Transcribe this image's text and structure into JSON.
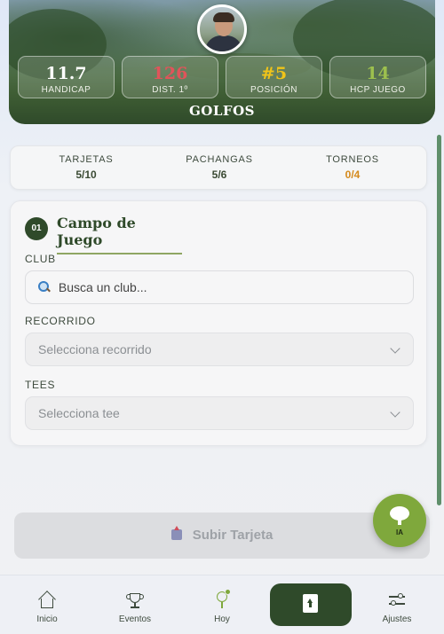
{
  "hero": {
    "title": "GOLFOS",
    "stats": [
      {
        "value": "11.7",
        "label": "HANDICAP",
        "color": "#ffffff"
      },
      {
        "value": "126",
        "label": "DIST. 1º",
        "color": "#e0545a"
      },
      {
        "value": "#5",
        "label": "POSICIÓN",
        "color": "#f0c419"
      },
      {
        "value": "14",
        "label": "HCP JUEGO",
        "color": "#9dc04e"
      }
    ]
  },
  "counters": [
    {
      "label": "TARJETAS",
      "value": "5/10"
    },
    {
      "label": "PACHANGAS",
      "value": "5/6"
    },
    {
      "label": "TORNEOS",
      "value": "0/4",
      "color": "#d58a1c"
    }
  ],
  "form": {
    "step": "01",
    "title": "Campo de Juego",
    "club_label": "CLUB",
    "club_placeholder": "Busca un club...",
    "recorrido_label": "RECORRIDO",
    "recorrido_value": "Selecciona recorrido",
    "tees_label": "TEES",
    "tees_value": "Selecciona tee"
  },
  "submit_label": "Subir Tarjeta",
  "fab_label": "IA",
  "nav": [
    {
      "label": "Inicio",
      "icon": "home-icon"
    },
    {
      "label": "Eventos",
      "icon": "trophy-icon"
    },
    {
      "label": "Hoy",
      "icon": "golf-icon"
    },
    {
      "label": "",
      "icon": "upload-doc-icon"
    },
    {
      "label": "Ajustes",
      "icon": "sliders-icon"
    }
  ],
  "colors": {
    "brand_dark": "#2f4a2a",
    "accent_green": "#7fa83c",
    "torneos_orange": "#d58a1c"
  }
}
